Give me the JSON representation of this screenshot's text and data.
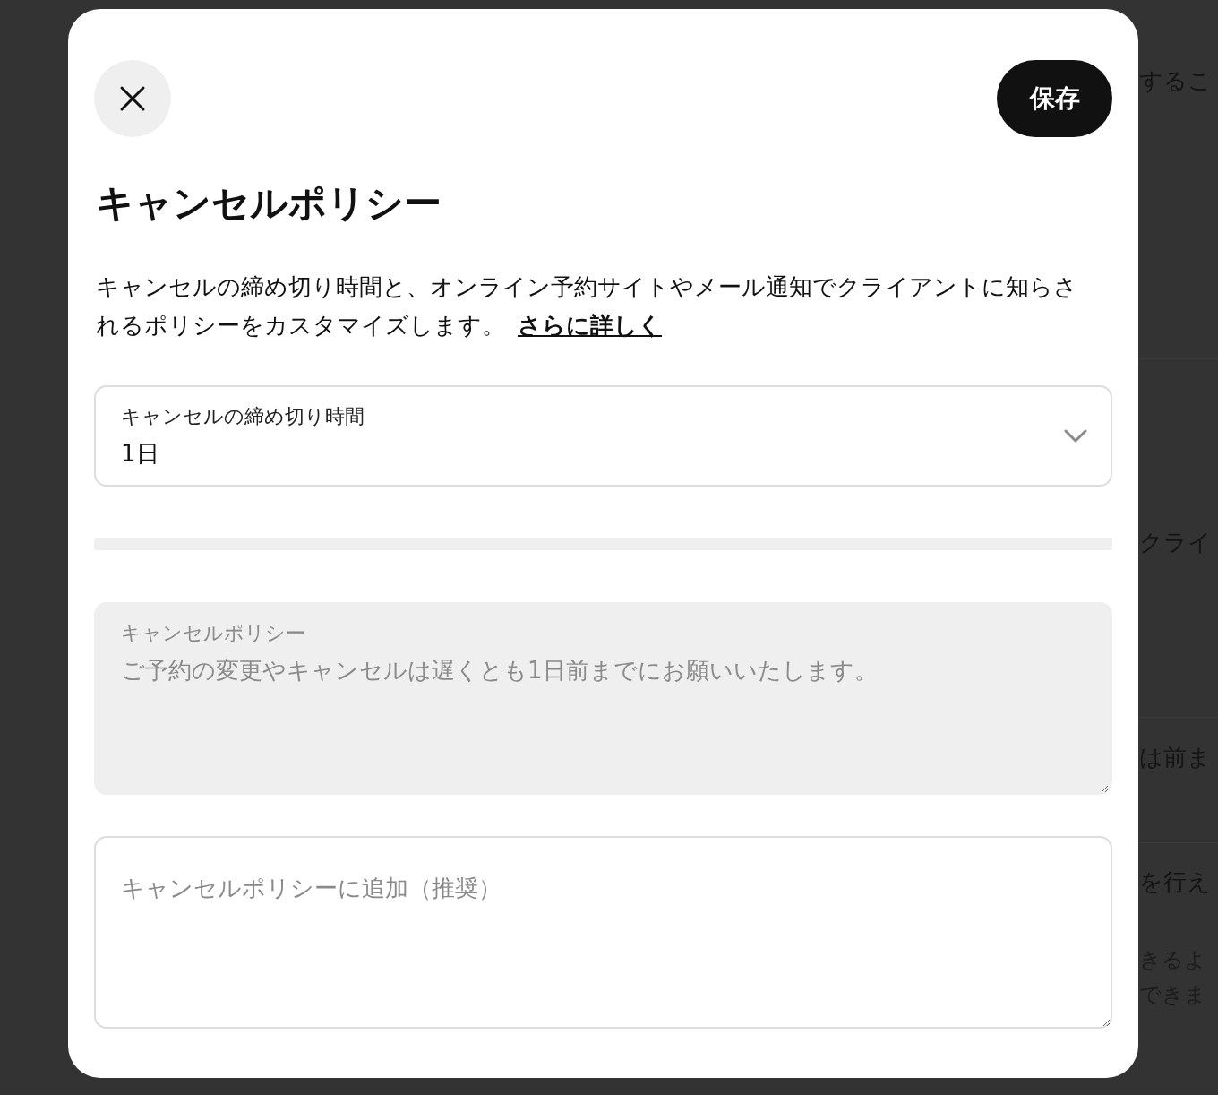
{
  "background": {
    "fragments": [
      {
        "text": "するこ"
      },
      {
        "text": "クライ"
      },
      {
        "text": "は前ま"
      },
      {
        "text": "を行え"
      },
      {
        "text": "きるよ"
      },
      {
        "text": "できま"
      }
    ]
  },
  "dialog": {
    "save_button": "保存",
    "title": "キャンセルポリシー",
    "description": "キャンセルの締め切り時間と、オンライン予約サイトやメール通知でクライアントに知らされるポリシーをカスタマイズします。",
    "learn_more_link": "さらに詳しく",
    "deadline_select": {
      "label": "キャンセルの締め切り時間",
      "value": "1日"
    },
    "policy_field": {
      "label": "キャンセルポリシー",
      "value": "ご予約の変更やキャンセルは遅くとも1日前までにお願いいたします。",
      "disabled": true
    },
    "addition_field": {
      "placeholder": "キャンセルポリシーに追加（推奨）"
    }
  }
}
